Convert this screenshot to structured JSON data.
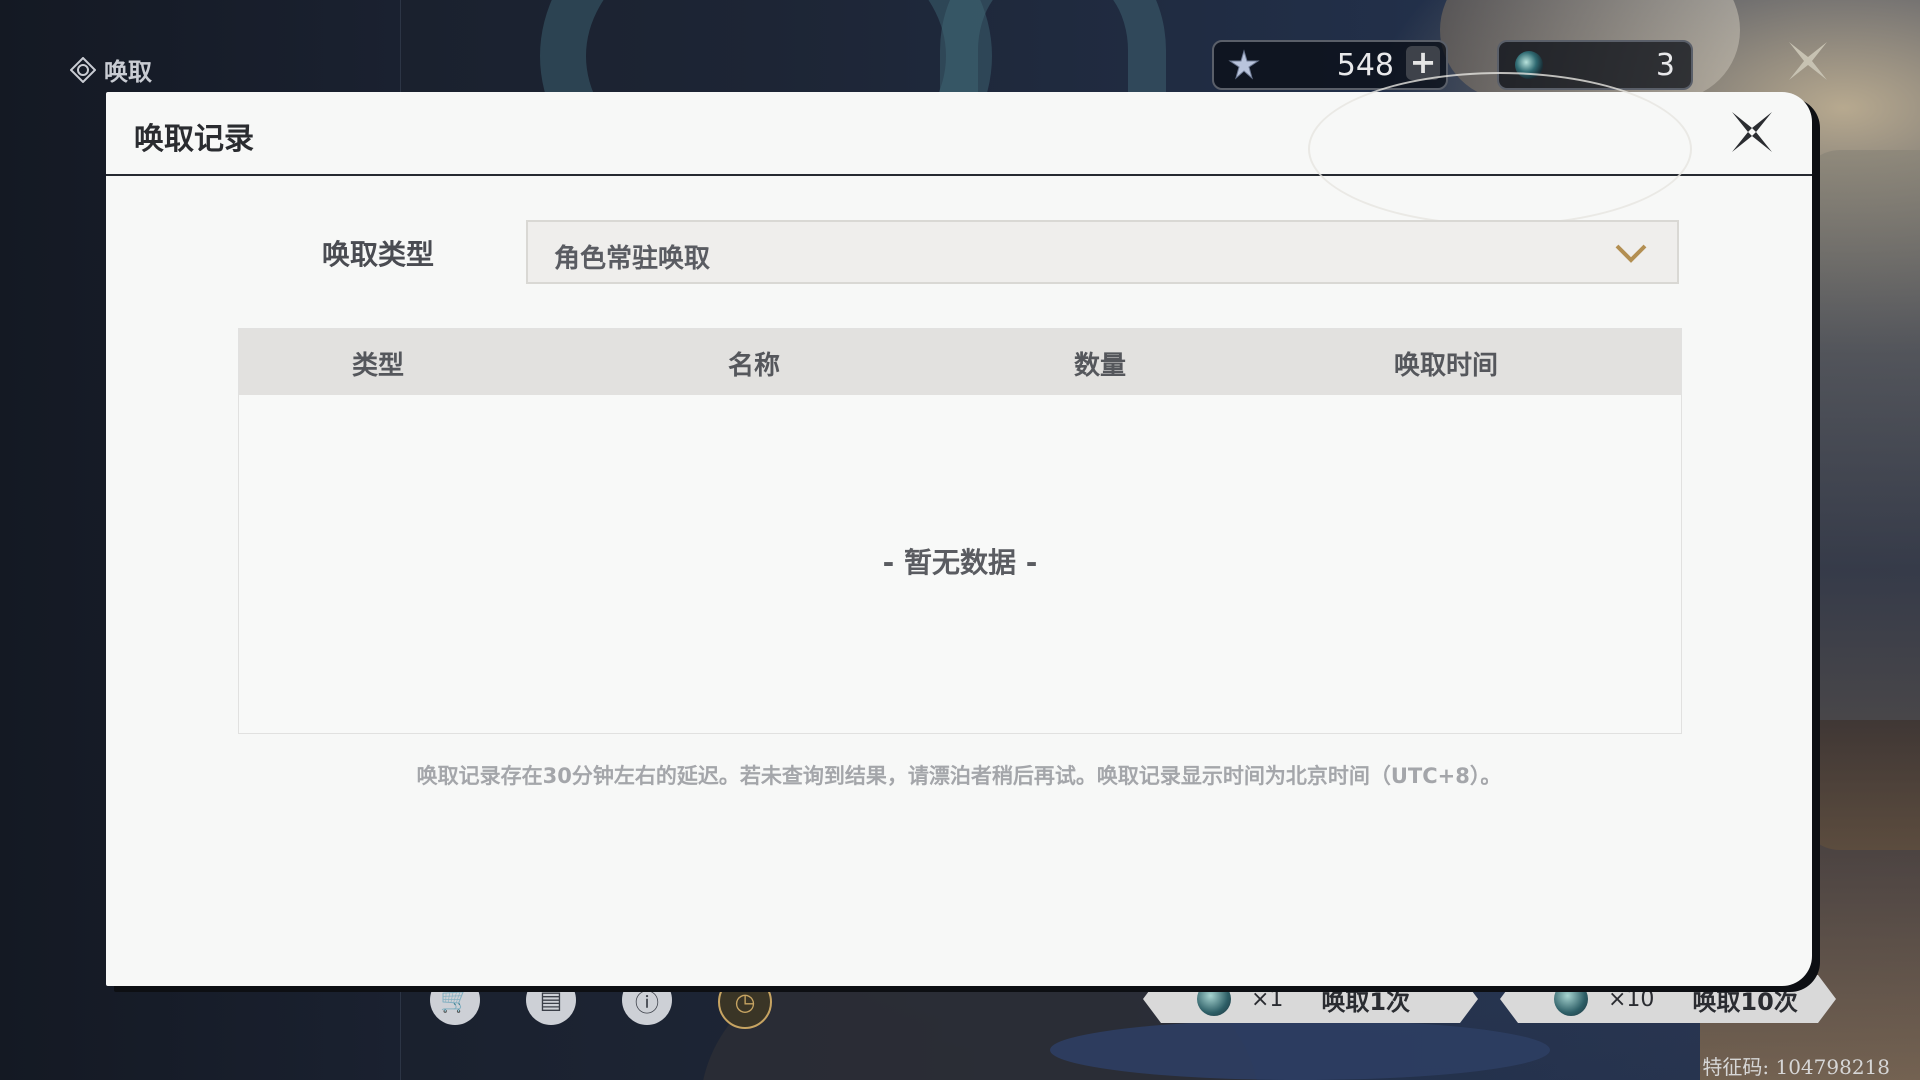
{
  "screen": {
    "title": "唤取",
    "currencies": [
      {
        "icon": "astrite-icon",
        "value": "548",
        "plus": "+"
      },
      {
        "icon": "radiant-tide-icon",
        "value": "3"
      }
    ],
    "bottom_bar": {
      "pull_single": {
        "multiplier": "×1",
        "label": "唤取1次"
      },
      "pull_ten": {
        "multiplier": "×10",
        "label": "唤取10次"
      }
    },
    "feature_code": "特征码: 104798218"
  },
  "dialog": {
    "title": "唤取记录",
    "filter": {
      "label": "唤取类型",
      "selected": "角色常驻唤取"
    },
    "table": {
      "columns": [
        "类型",
        "名称",
        "数量",
        "唤取时间"
      ],
      "rows": [],
      "empty_text": "- 暂无数据 -"
    },
    "note": "唤取记录存在30分钟左右的延迟。若未查询到结果，请漂泊者稍后再试。唤取记录显示时间为北京时间（UTC+8）。"
  },
  "colors": {
    "dialog_bg": "#f7f8f7",
    "header_row_bg": "#e2e1df",
    "accent_gold": "#b38f52",
    "text_dark": "#2a2c30"
  }
}
